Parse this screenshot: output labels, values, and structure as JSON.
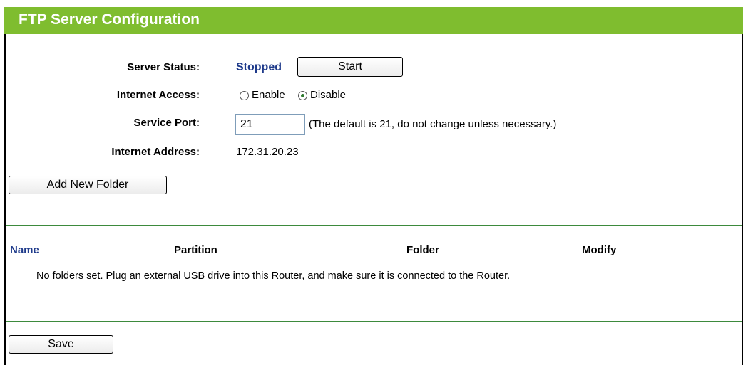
{
  "title": "FTP Server Configuration",
  "server_status": {
    "label": "Server Status:",
    "value": "Stopped",
    "button": "Start"
  },
  "internet_access": {
    "label": "Internet Access:",
    "options": [
      "Enable",
      "Disable"
    ],
    "selected": "Disable"
  },
  "service_port": {
    "label": "Service Port:",
    "value": "21",
    "hint": "(The default is 21, do not change unless necessary.)"
  },
  "internet_address": {
    "label": "Internet Address:",
    "value": "172.31.20.23"
  },
  "add_folder_button": "Add New Folder",
  "table": {
    "headers": [
      "Name",
      "Partition",
      "Folder",
      "Modify"
    ],
    "empty_message": "No folders set. Plug an external USB drive into this Router, and make sure it is connected to the Router."
  },
  "save_button": "Save",
  "colors": {
    "title_bar": "#7fbd2f",
    "status_text": "#1f3b8b",
    "name_header": "#1f3b8b",
    "divider": "#3d8a3d"
  }
}
